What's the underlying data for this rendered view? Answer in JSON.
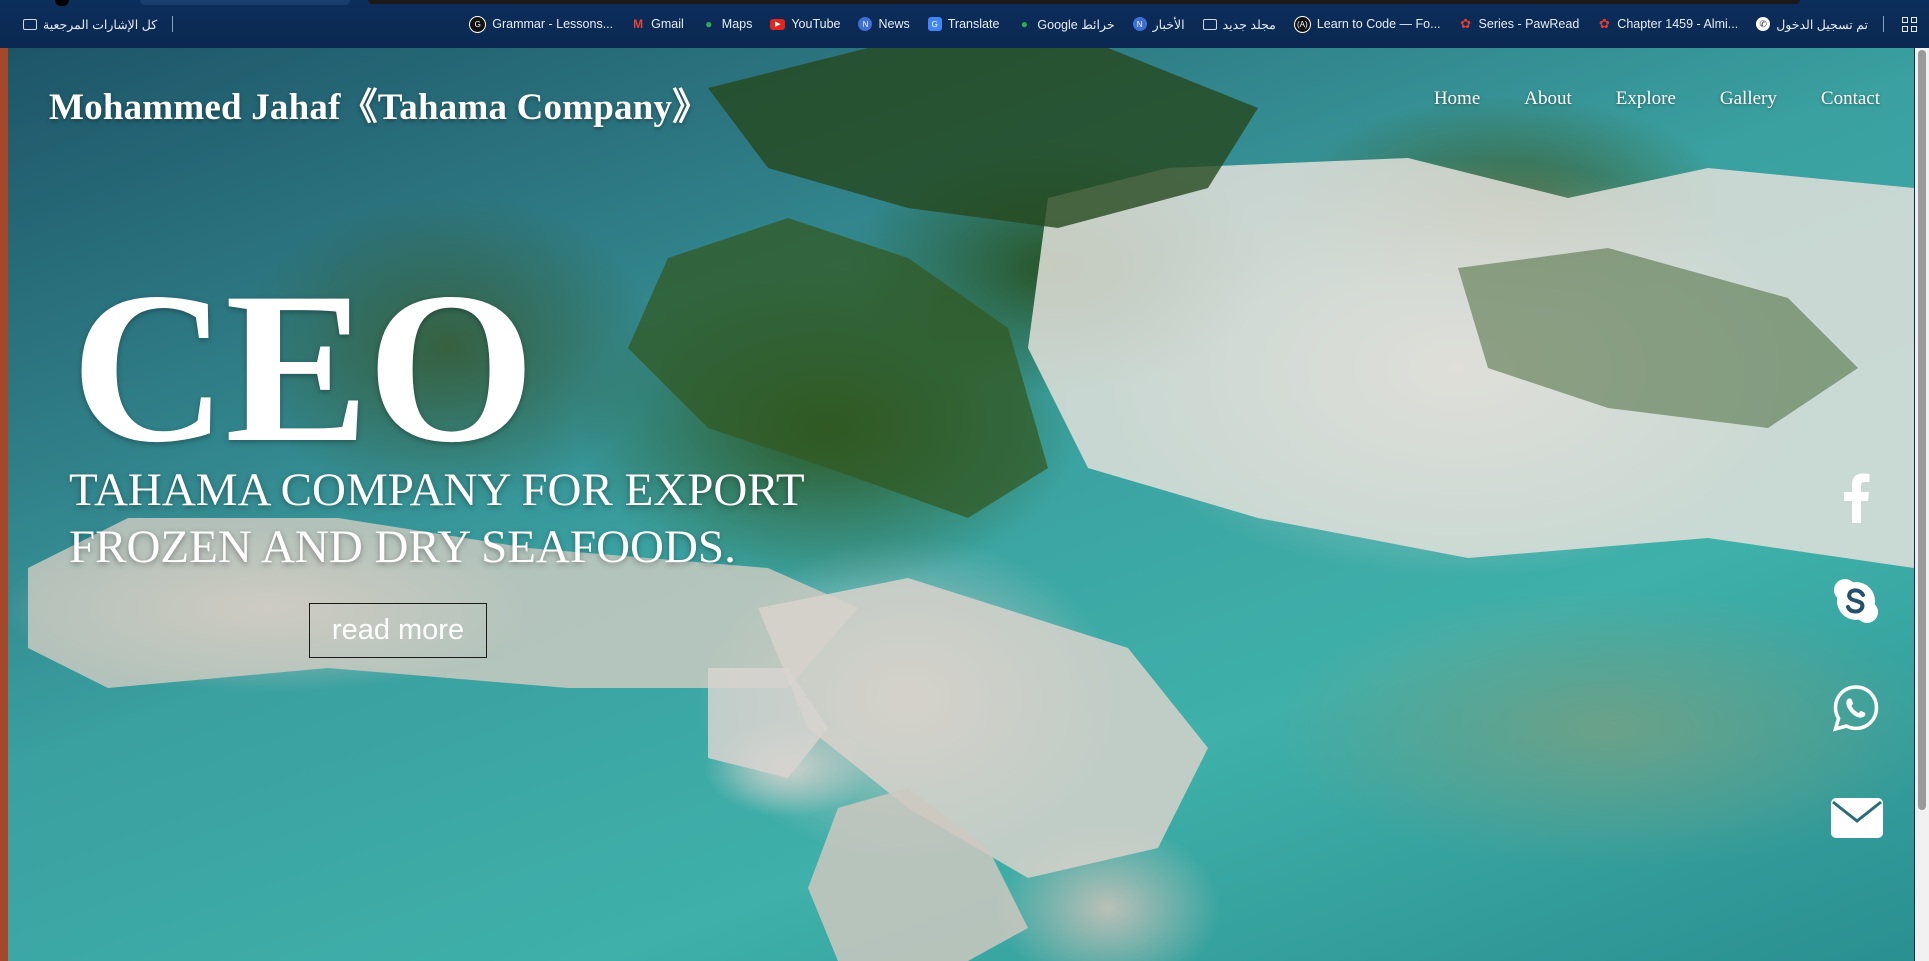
{
  "bookmarks": {
    "all_bookmarks": "كل الإشارات المرجعية",
    "items": [
      {
        "label": "تم تسجيل الدخول",
        "icon": "phone-icon"
      },
      {
        "label": "Chapter 1459 - Almi...",
        "icon": "paw-icon"
      },
      {
        "label": "Series - PawRead",
        "icon": "paw-icon"
      },
      {
        "label": "Learn to Code — Fo...",
        "icon": "freecodecamp-icon"
      },
      {
        "label": "مجلد جديد",
        "icon": "folder-icon"
      },
      {
        "label": "الأخبار",
        "icon": "news-icon"
      },
      {
        "label": "Google خرائط",
        "icon": "maps-icon"
      },
      {
        "label": "Translate",
        "icon": "translate-icon"
      },
      {
        "label": "News",
        "icon": "news-icon"
      },
      {
        "label": "YouTube",
        "icon": "youtube-icon"
      },
      {
        "label": "Maps",
        "icon": "maps-icon"
      },
      {
        "label": "Gmail",
        "icon": "gmail-icon"
      },
      {
        "label": "Grammar - Lessons...",
        "icon": "g-icon"
      }
    ]
  },
  "header": {
    "logo": "Mohammed Jahaf《Tahama Company》",
    "nav": [
      "Home",
      "About",
      "Explore",
      "Gallery",
      "Contact"
    ]
  },
  "hero": {
    "headline": "CEO",
    "tagline": "TAHAMA COMPANY FOR EXPORT FROZEN AND DRY SEAFOODS.",
    "button": "read more"
  },
  "social": [
    "facebook-icon",
    "skype-icon",
    "whatsapp-icon",
    "envelope-icon"
  ]
}
